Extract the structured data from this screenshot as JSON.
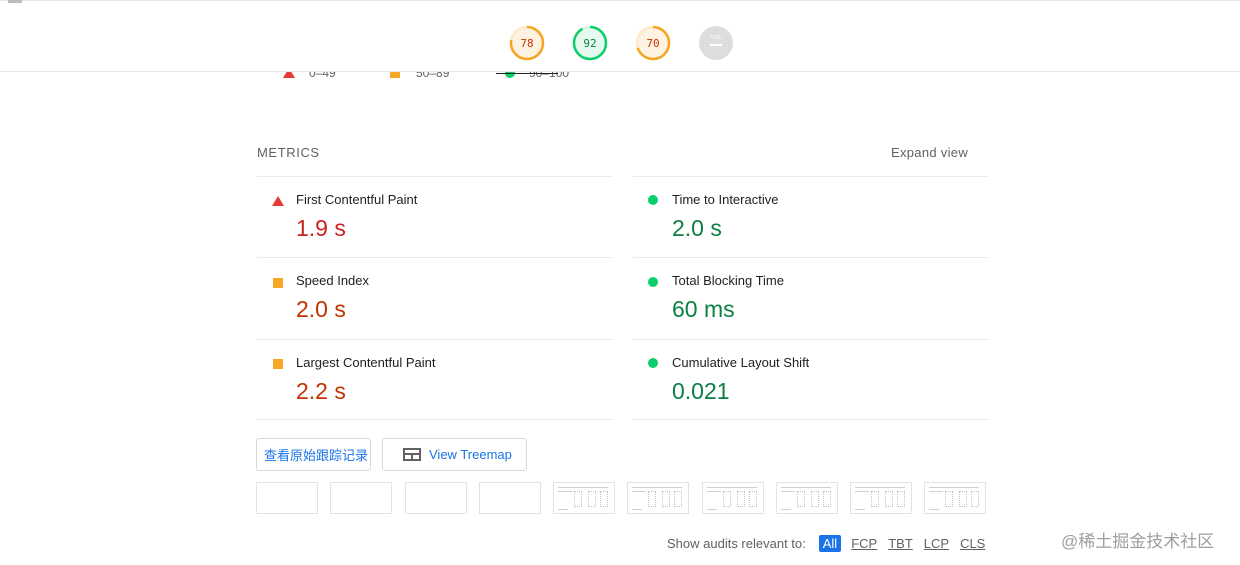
{
  "gauges": [
    {
      "label": "78",
      "color": "#f5a623",
      "text_color": "#c33300",
      "score": 0.78
    },
    {
      "label": "92",
      "color": "#0cce6b",
      "text_color": "#0b8043",
      "score": 0.92
    },
    {
      "label": "70",
      "color": "#f5a623",
      "text_color": "#c33300",
      "score": 0.7
    },
    {
      "label": "FAIL",
      "color": "#dddddd",
      "text_color": "#ffffff",
      "score": 0
    }
  ],
  "legend": [
    {
      "label": "0–49",
      "icon": "red-triangle-icon"
    },
    {
      "label": "50–89",
      "icon": "orange-square-icon"
    },
    {
      "label": "90–100",
      "icon": "green-circle-icon"
    }
  ],
  "metrics": {
    "title": "METRICS",
    "expand_label": "Expand view",
    "left": [
      {
        "name": "First Contentful Paint",
        "value": "1.9 s",
        "status": "fail"
      },
      {
        "name": "Speed Index",
        "value": "2.0 s",
        "status": "average"
      },
      {
        "name": "Largest Contentful Paint",
        "value": "2.2 s",
        "status": "average"
      }
    ],
    "right": [
      {
        "name": "Time to Interactive",
        "value": "2.0 s",
        "status": "pass"
      },
      {
        "name": "Total Blocking Time",
        "value": "60 ms",
        "status": "pass"
      },
      {
        "name": "Cumulative Layout Shift",
        "value": "0.021",
        "status": "pass"
      }
    ]
  },
  "actions": {
    "trace_label": "查看原始跟踪记录",
    "treemap_label": "View Treemap"
  },
  "filter": {
    "label": "Show audits relevant to:",
    "options": [
      "All",
      "FCP",
      "TBT",
      "LCP",
      "CLS"
    ],
    "selected": "All"
  },
  "watermark": "@稀土掘金技术社区",
  "colors": {
    "fail": "#e53935",
    "average": "#f5a623",
    "pass": "#0cce6b",
    "accent": "#1a73e8"
  }
}
